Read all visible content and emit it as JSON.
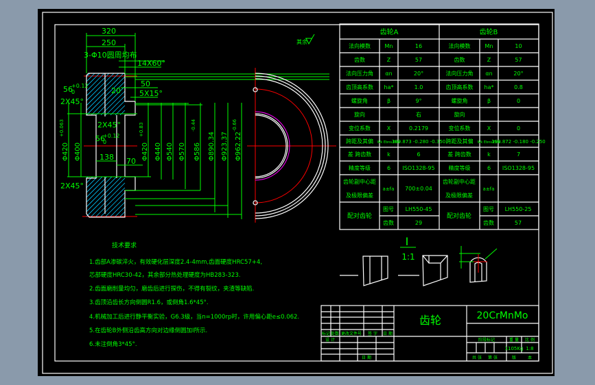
{
  "colors": {
    "background": "#8a9aab",
    "paper": "#000000",
    "text": "#00ff00",
    "outline": "#ffffff",
    "centerline": "#ff0000",
    "hatch": "#00c8ff",
    "bore": "#ff00ff"
  },
  "section_view": {
    "dims": {
      "d320": "320",
      "d250": "250",
      "holes": "3-Φ10圆周均布",
      "chamfer_14x60": "14X60°",
      "d50": "50",
      "chamfer_5x15": "5X15°",
      "d20": "20",
      "d56_top": "56",
      "tol_56_top": "+0.12",
      "tol_56_top_low": "0",
      "chamfer_2x45_a": "2X45°",
      "chamfer_2x45_b": "2X45°",
      "chamfer_2x45_c": "2X45°",
      "d56_mid": "56",
      "tol_56_mid": "+0.12",
      "tol_56_mid_low": "0",
      "d138": "138",
      "d70": "70",
      "phi420_left": "Φ420",
      "tol_420_left": "+0.063",
      "phi400": "Φ400",
      "phi420_right": "Φ420",
      "tol_420_right": "+0.83",
      "phi440": "Φ440",
      "phi540": "Φ540",
      "phi570": "Φ570",
      "phi586": "Φ586",
      "tol_586": "-0.44",
      "phi890": "Φ890.34",
      "phi923": "Φ923.37",
      "phi962": "Φ962.22",
      "tol_962": "-0.66"
    }
  },
  "roughness_note": "其余",
  "table": {
    "gearA": "齿轮A",
    "gearB": "齿轮B",
    "rows": [
      [
        "法向模数",
        "Mn",
        "16",
        "法向模数",
        "Mn",
        "10"
      ],
      [
        "齿数",
        "Z",
        "57",
        "齿数",
        "Z",
        "57"
      ],
      [
        "法向压力角",
        "αn",
        "20°",
        "法向压力角",
        "αn",
        "20°"
      ],
      [
        "齿顶高系数",
        "ha*",
        "1.0",
        "齿顶高系数",
        "ha*",
        "0.8"
      ],
      [
        "螺旋角",
        "β",
        "9°",
        "螺旋角",
        "β",
        "0"
      ],
      [
        "旋向",
        "",
        "右",
        "旋向",
        "",
        ""
      ],
      [
        "变位系数",
        "X",
        "0.2179",
        "变位系数",
        "X",
        "0"
      ],
      [
        "跨距及其偏",
        "Wk Ebns Ebni",
        "369.873 -0.280 -0.350",
        "跨距及其偏",
        "Wk Ebns Ebni",
        "199.872 -0.180 -0.250"
      ],
      [
        "差 跨齿数",
        "k",
        "6",
        "差 跨齿数",
        "k",
        "7"
      ],
      [
        "精度等级",
        "6",
        "ISO1328-95",
        "精度等级",
        "6",
        "ISO1328-95"
      ]
    ],
    "center": {
      "labelA1": "齿轮副中心距",
      "labelA2": "及极限偏差",
      "symA": "a±fa",
      "valA": "700±0.04",
      "labelB1": "齿轮副中心距",
      "labelB2": "及极限偏差",
      "symB": "a±fa",
      "valB": ""
    },
    "mate": {
      "labelA": "配对齿轮",
      "drawA": "图号",
      "drawValA": "LH550-45",
      "teethA": "齿数",
      "teethValA": "29",
      "labelB": "配对齿轮",
      "drawB": "图号",
      "drawValB": "LH550-25",
      "teethB": "齿数",
      "teethValB": "57"
    }
  },
  "detail": {
    "label": "I",
    "scale": "1:1"
  },
  "requirements": {
    "title": "技术要求",
    "lines": [
      "1.齿部A渗碳淬火，有效硬化层深度2.4-4mm,齿面硬度HRC57+4,",
      "芯部硬度HRC30-42，其余部分热处理硬度为HB283-323.",
      "2.齿面磨削量均匀，磨齿后进行探伤，不得有裂纹，夹渣等缺陷.",
      "3.齿顶沿齿长方向倒圆R1.6，或倒角1.6*45°.",
      "4.机械加工后进行静平衡实验，G6.3级，当n=1000rp时，许用偏心距e≤0.062.",
      "5.在齿轮B外侧沿齿高方向对边缘倒圆加Ⅰ所示.",
      "6.未注倒角3*45°."
    ]
  },
  "title_block": {
    "part_name": "齿轮",
    "material": "20CrMnMo",
    "left_labels": [
      "标记",
      "处数",
      "更改文件号",
      "签 字",
      "日 期"
    ],
    "design": "设 计",
    "date": "日 期",
    "stage": "阶段标记",
    "weight_label": "重 量",
    "scale_label": "比 例",
    "weight": "1105Kg",
    "scale": "1:8",
    "bottom": [
      "共 张",
      "第 张",
      "版",
      "本"
    ]
  }
}
